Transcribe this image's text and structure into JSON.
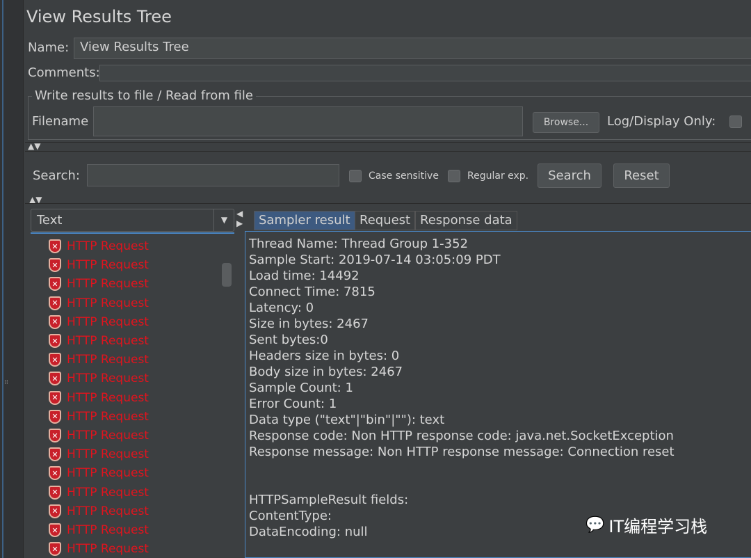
{
  "title": "View Results Tree",
  "name_label": "Name:",
  "name_value": "View Results Tree",
  "comments_label": "Comments:",
  "file_group": {
    "legend": "Write results to file / Read from file",
    "filename_label": "Filename",
    "filename_value": "",
    "browse": "Browse...",
    "log_only": "Log/Display Only:"
  },
  "search": {
    "label": "Search:",
    "value": "",
    "case_sensitive": "Case sensitive",
    "regex": "Regular exp.",
    "search_btn": "Search",
    "reset_btn": "Reset"
  },
  "renderer": "Text",
  "list_items": [
    "HTTP Request",
    "HTTP Request",
    "HTTP Request",
    "HTTP Request",
    "HTTP Request",
    "HTTP Request",
    "HTTP Request",
    "HTTP Request",
    "HTTP Request",
    "HTTP Request",
    "HTTP Request",
    "HTTP Request",
    "HTTP Request",
    "HTTP Request",
    "HTTP Request",
    "HTTP Request",
    "HTTP Request"
  ],
  "tabs": [
    "Sampler result",
    "Request",
    "Response data"
  ],
  "active_tab": "Sampler result",
  "result_lines": [
    "Thread Name: Thread Group 1-352",
    "Sample Start: 2019-07-14 03:05:09 PDT",
    "Load time: 14492",
    "Connect Time: 7815",
    "Latency: 0",
    "Size in bytes: 2467",
    "Sent bytes:0",
    "Headers size in bytes: 0",
    "Body size in bytes: 2467",
    "Sample Count: 1",
    "Error Count: 1",
    "Data type (\"text\"|\"bin\"|\"\"): text",
    "Response code: Non HTTP response code: java.net.SocketException",
    "Response message: Non HTTP response message: Connection reset",
    "",
    "",
    "HTTPSampleResult fields:",
    "ContentType: ",
    "DataEncoding: null"
  ],
  "watermark": "IT编程学习栈",
  "colors": {
    "background": "#3c3f41",
    "error_text": "#e0141e",
    "accent": "#4a88c7",
    "active_tab": "#3d5a80"
  }
}
